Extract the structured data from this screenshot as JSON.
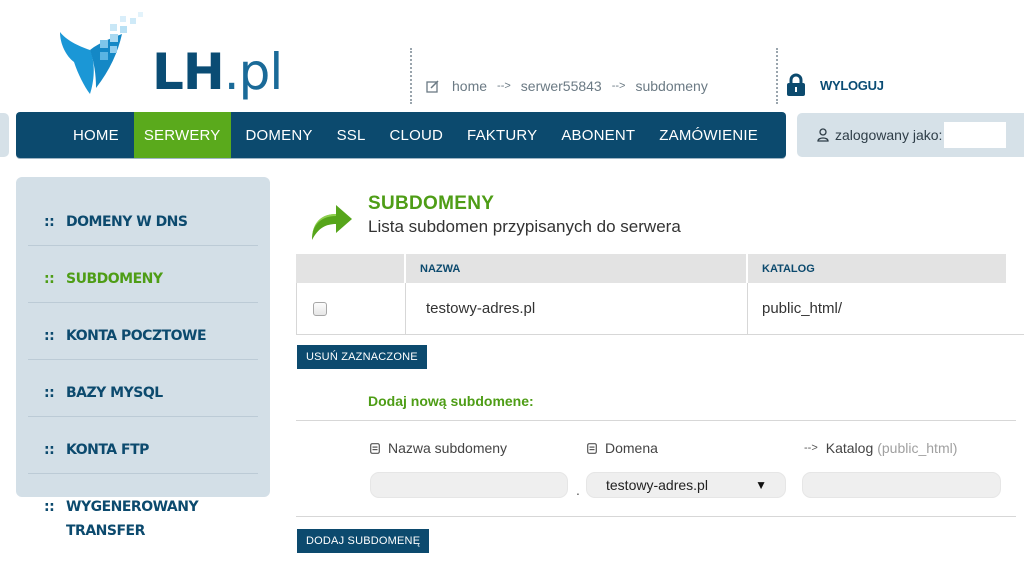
{
  "header": {
    "logo_text": "LH",
    "logo_suffix": ".pl",
    "breadcrumb": [
      "home",
      "serwer55843",
      "subdomeny"
    ],
    "logout_label": "WYLOGUJ"
  },
  "nav": {
    "items": [
      "HOME",
      "SERWERY",
      "DOMENY",
      "SSL",
      "CLOUD",
      "FAKTURY",
      "ABONENT",
      "ZAMÓWIENIE"
    ],
    "active": "SERWERY",
    "user_label": "zalogowany jako:"
  },
  "sidebar": {
    "bullet": "::",
    "items": [
      {
        "label": "DOMENY W DNS",
        "active": false
      },
      {
        "label": "SUBDOMENY",
        "active": true
      },
      {
        "label": "KONTA POCZTOWE",
        "active": false
      },
      {
        "label": "BAZY MYSQL",
        "active": false
      },
      {
        "label": "KONTA FTP",
        "active": false
      },
      {
        "label": "WYGENEROWANY TRANSFER",
        "active": false
      }
    ]
  },
  "main": {
    "title": "SUBDOMENY",
    "subtitle": "Lista subdomen przypisanych do serwera",
    "table": {
      "columns": [
        "NAZWA",
        "KATALOG"
      ],
      "rows": [
        {
          "checked": false,
          "name": "testowy-adres.pl",
          "directory": "public_html/"
        }
      ]
    },
    "delete_button": "USUŃ ZAZNACZONE",
    "add": {
      "title": "Dodaj nową subdomene:",
      "subdomain_label": "Nazwa subdomeny",
      "subdomain_value": "",
      "separator": ".",
      "domain_label": "Domena",
      "domain_selected": "testowy-adres.pl",
      "directory_label": "Katalog",
      "directory_hint": "(public_html)",
      "directory_value": "",
      "submit_button": "DODAJ SUBDOMENĘ"
    }
  },
  "colors": {
    "brand_blue": "#0c4a6e",
    "brand_green": "#5aaa1c",
    "panel": "#d3dfe7"
  }
}
